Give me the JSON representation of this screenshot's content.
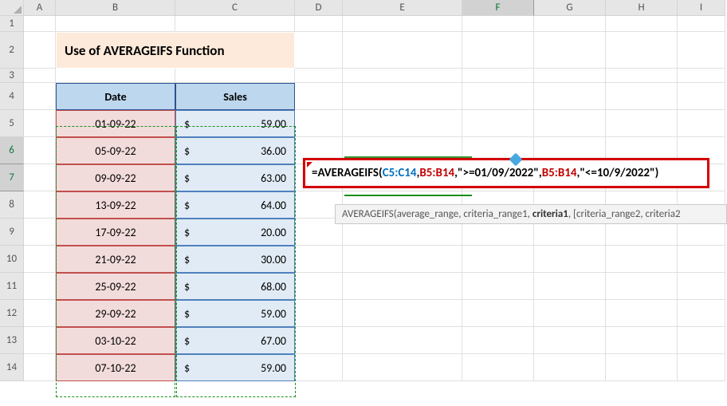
{
  "columns": [
    "A",
    "B",
    "C",
    "D",
    "E",
    "F",
    "G",
    "H",
    "I"
  ],
  "active_col": "F",
  "active_row": 7,
  "sel_rows": [
    "6",
    "7"
  ],
  "title": "Use of AVERAGEIFS Function",
  "headers": {
    "date": "Date",
    "sales": "Sales"
  },
  "rows": [
    {
      "n": 5,
      "date": "01-09-22",
      "sales": "59.00"
    },
    {
      "n": 6,
      "date": "05-09-22",
      "sales": "36.00"
    },
    {
      "n": 7,
      "date": "09-09-22",
      "sales": "63.00"
    },
    {
      "n": 8,
      "date": "13-09-22",
      "sales": "64.00"
    },
    {
      "n": 9,
      "date": "17-09-22",
      "sales": "20.00"
    },
    {
      "n": 10,
      "date": "21-09-22",
      "sales": "30.00"
    },
    {
      "n": 11,
      "date": "25-09-22",
      "sales": "68.00"
    },
    {
      "n": 12,
      "date": "29-09-22",
      "sales": "59.00"
    },
    {
      "n": 13,
      "date": "03-10-22",
      "sales": "67.00"
    },
    {
      "n": 14,
      "date": "07-10-22",
      "sales": "59.00"
    }
  ],
  "currency": "$",
  "formula": {
    "eq": "=",
    "fn": "AVERAGEIFS",
    "open": "(",
    "ref1": "C5:C14",
    "c1": ",",
    "ref2a": "B5:B14",
    "c2": ",",
    "str1": "\">=01/09/2022\"",
    "c3": ",",
    "ref2b": "B5:B14",
    "c4": ",",
    "str2": "\"<=10/9/2022\"",
    "close": ")"
  },
  "tooltip": {
    "fn": "AVERAGEIFS",
    "open": "(",
    "a1": "average_range",
    "a2": "criteria_range1",
    "a3": "criteria1",
    "a4": "[criteria_range2, criteria2",
    "close": ")"
  }
}
